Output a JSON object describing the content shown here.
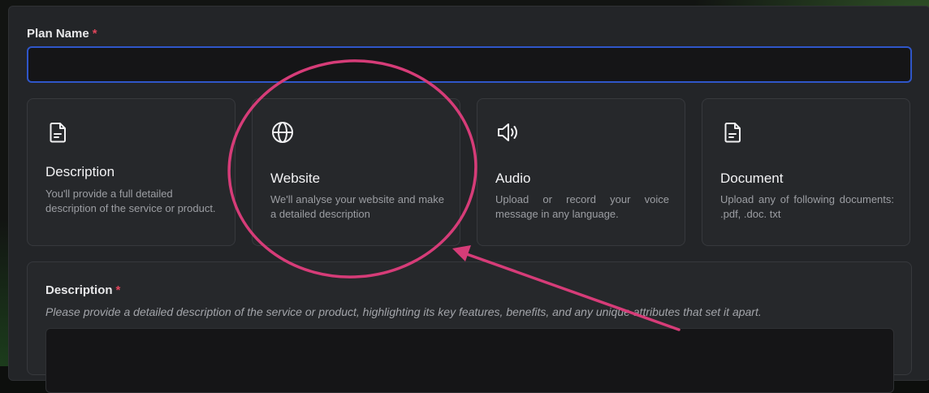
{
  "form": {
    "plan_name_label": "Plan Name",
    "required_mark": "*",
    "plan_name_value": ""
  },
  "source_options": [
    {
      "icon": "document-icon",
      "title": "Description",
      "text": "You'll provide a full detailed description of the service or product."
    },
    {
      "icon": "globe-icon",
      "title": "Website",
      "text": "We'll analyse your website and make a detailed description"
    },
    {
      "icon": "speaker-icon",
      "title": "Audio",
      "text": "Upload or record your voice message in any language."
    },
    {
      "icon": "document-icon",
      "title": "Document",
      "text": "Upload any of following documents: .pdf, .doc. txt"
    }
  ],
  "description_section": {
    "label": "Description",
    "required_mark": "*",
    "hint": "Please provide a detailed description of the service or product, highlighting its key features, benefits, and any unique attributes that set it apart.",
    "value": ""
  },
  "annotation": {
    "color": "#d63c78",
    "highlight": "circle around Website option",
    "arrow": "pointing to Website option"
  },
  "colors": {
    "input_focus_border": "#2f56c9",
    "required": "#e0455b",
    "panel": "#232528"
  }
}
